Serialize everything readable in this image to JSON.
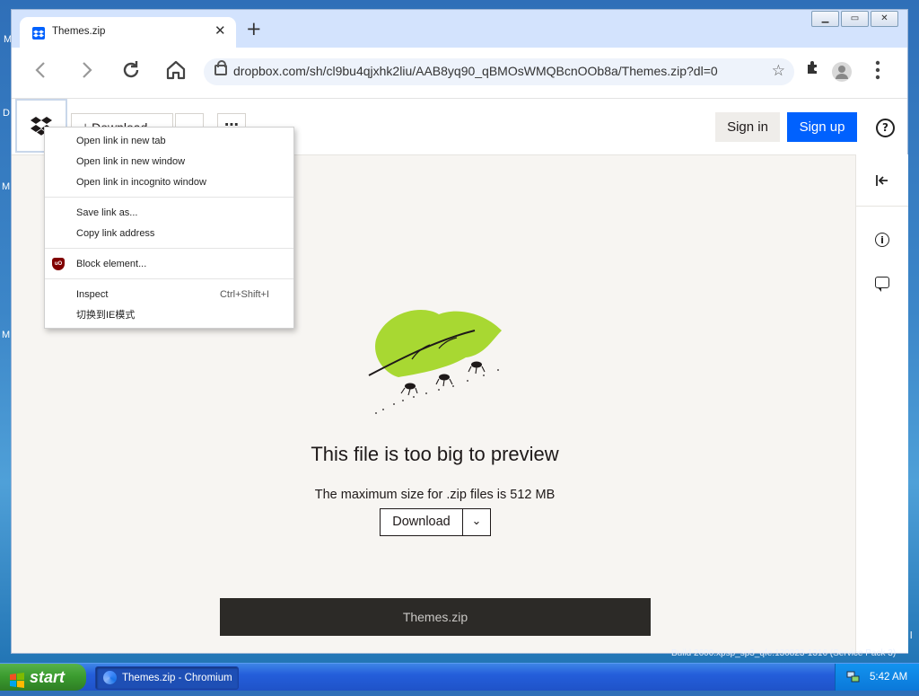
{
  "browser": {
    "tab_title": "Themes.zip",
    "url": "dropbox.com/sh/cl9bu4qjxhk2liu/AAB8yq90_qBMOsWMQBcnOOb8a/Themes.zip?dl=0"
  },
  "header": {
    "download_label": "Download",
    "sign_in_label": "Sign in",
    "sign_up_label": "Sign up",
    "help_label": "?"
  },
  "preview": {
    "title": "This file is too big to preview",
    "subtitle": "The maximum size for .zip files is 512 MB",
    "download_label": "Download",
    "file_name": "Themes.zip"
  },
  "context_menu": {
    "items": [
      {
        "label": "Open link in new tab"
      },
      {
        "label": "Open link in new window"
      },
      {
        "label": "Open link in incognito window"
      },
      {
        "label": "Save link as..."
      },
      {
        "label": "Copy link address"
      },
      {
        "label": "Block element..."
      },
      {
        "label": "Inspect",
        "shortcut": "Ctrl+Shift+I"
      },
      {
        "label": "切换到IE模式"
      }
    ]
  },
  "taskbar": {
    "start_label": "start",
    "task_label": "Themes.zip - Chromium",
    "clock": "5:42 AM",
    "build_text": "Build 2600.xpsp_sp3_qfe.130823-1316 (Service Pack 3)"
  },
  "colors": {
    "dropbox_blue": "#0061fe",
    "leaf_green": "#a8d832",
    "xp_taskbar_blue": "#245edb"
  }
}
